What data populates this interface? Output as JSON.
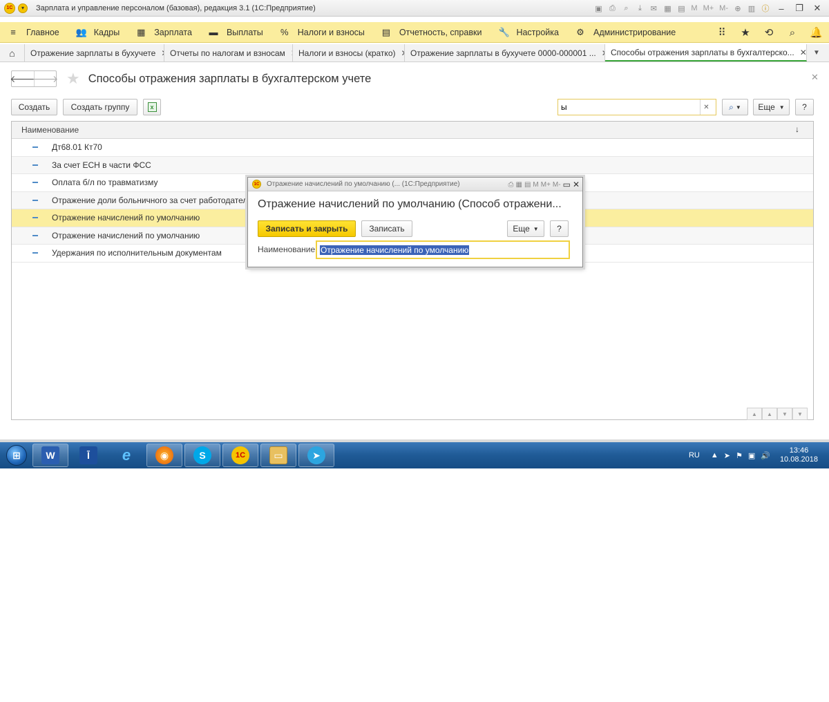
{
  "window": {
    "title": "Зарплата и управление персоналом (базовая), редакция 3.1  (1С:Предприятие)",
    "logo_text": "1С",
    "toolbar_text": [
      "M",
      "M+",
      "M-"
    ]
  },
  "sections": [
    {
      "label": "Главное",
      "icon": "menu-icon"
    },
    {
      "label": "Кадры",
      "icon": "people-icon"
    },
    {
      "label": "Зарплата",
      "icon": "calculator-icon"
    },
    {
      "label": "Выплаты",
      "icon": "wallet-icon"
    },
    {
      "label": "Налоги и взносы",
      "icon": "percent-icon"
    },
    {
      "label": "Отчетность, справки",
      "icon": "report-icon"
    },
    {
      "label": "Настройка",
      "icon": "wrench-icon"
    },
    {
      "label": "Администрирование",
      "icon": "gear-icon"
    }
  ],
  "tabs": [
    {
      "label": "Отражение зарплаты в бухучете"
    },
    {
      "label": "Отчеты по налогам и взносам"
    },
    {
      "label": "Налоги и взносы (кратко)"
    },
    {
      "label": "Отражение зарплаты в бухучете 0000-000001 ..."
    },
    {
      "label": "Способы отражения зарплаты в бухгалтерско..."
    }
  ],
  "form": {
    "title": "Способы отражения зарплаты в бухгалтерском учете",
    "buttons": {
      "create": "Создать",
      "create_group": "Создать группу",
      "more": "Еще",
      "help": "?"
    },
    "search": {
      "value": "ы"
    },
    "list": {
      "column": "Наименование",
      "rows": [
        "Дт68.01 Кт70",
        "За счет ЕСН в части ФСС",
        "Оплата б/л по травматизму",
        "Отражение доли больничного за счет работодателя",
        "Отражение начислений по умолчанию",
        "Отражение начислений по умолчанию",
        "Удержания по исполнительным документам"
      ],
      "selected_index": 4
    }
  },
  "dialog": {
    "window_title": "Отражение начислений по умолчанию (... (1С:Предприятие)",
    "heading": "Отражение начислений по умолчанию (Способ отражени...",
    "save_close": "Записать и закрыть",
    "save": "Записать",
    "more": "Еще",
    "help": "?",
    "field_label": "Наименование:",
    "field_value": "Отражение начислений по умолчанию",
    "toolbar_text": [
      "M",
      "M+",
      "M-"
    ]
  },
  "taskbar": {
    "apps": [
      "word-icon",
      "app-icon",
      "ie-icon",
      "firefox-icon",
      "skype-icon",
      "1c-icon",
      "explorer-icon",
      "telegram-icon"
    ],
    "language": "RU",
    "time": "13:46",
    "date": "10.08.2018"
  },
  "colors": {
    "sections_bg": "#fbed9e",
    "selected_row": "#fbee9f",
    "primary_button": "#f5c800",
    "active_tab_underline": "#3aa63a",
    "taskbar": "#1f5a96"
  }
}
